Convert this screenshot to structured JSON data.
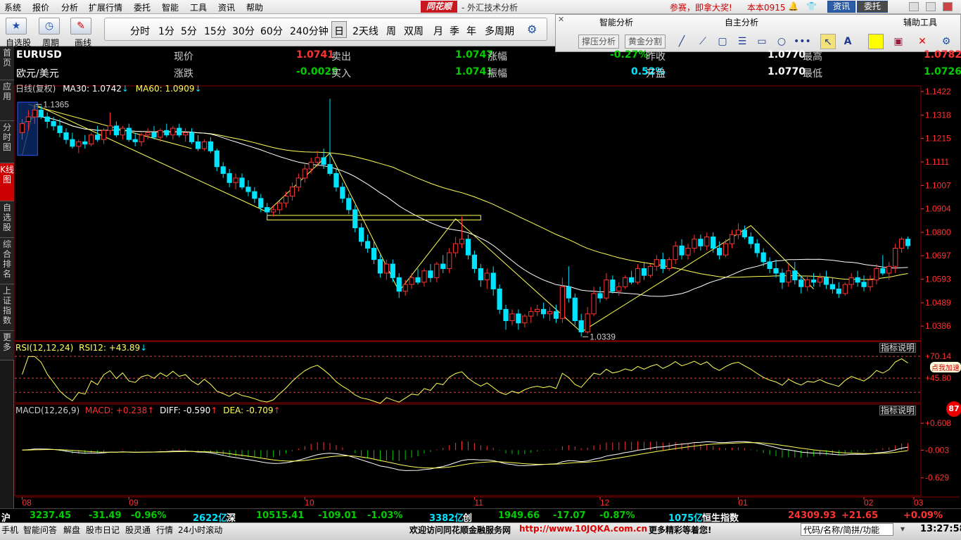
{
  "menu": [
    "系统",
    "报价",
    "分析",
    "扩展行情",
    "委托",
    "智能",
    "工具",
    "资讯",
    "帮助"
  ],
  "logo": "同花顺",
  "window_title": "- 外汇技术分析",
  "promo": "参赛，即拿大奖!",
  "version": "本本0915",
  "btn_zixun": "资讯",
  "btn_weituo": "委托",
  "toolbar": {
    "labels": [
      "自选股",
      "周期",
      "画线"
    ]
  },
  "periods": [
    "分时",
    "1分",
    "5分",
    "15分",
    "30分",
    "60分",
    "240分钟",
    "日",
    "2天线",
    "周",
    "双周",
    "月",
    "季",
    "年",
    "多周期"
  ],
  "analysis": {
    "smart": "智能分析",
    "self": "自主分析",
    "aux": "辅助工具",
    "btn1": "撑压分析",
    "btn2": "黄金分割"
  },
  "leftnav": [
    "首页",
    "应用",
    "分时图",
    "K线图",
    "自选股",
    "综合排名",
    "上证指数",
    "更多"
  ],
  "quote": {
    "symbol": "EURUSD",
    "name": "欧元/美元",
    "row1": [
      {
        "label": "现价",
        "value": "1.0741"
      },
      {
        "label": "卖出",
        "value": "1.0747"
      },
      {
        "label": "涨幅",
        "value": "-0.27%"
      },
      {
        "label": "昨收",
        "value": "1.0770"
      },
      {
        "label": "最高",
        "value": "1.0782"
      }
    ],
    "row2": [
      {
        "label": "涨跌",
        "value": "-0.0029"
      },
      {
        "label": "买入",
        "value": "1.0741"
      },
      {
        "label": "振幅",
        "value": "0.52%"
      },
      {
        "label": "开盘",
        "value": "1.0770"
      },
      {
        "label": "最低",
        "value": "1.0726"
      }
    ]
  },
  "indicator_line": {
    "mode": "日线(复权)",
    "ma30_label": "MA30: 1.0742",
    "ma60_label": "MA60: 1.0909",
    "arrow": "↓"
  },
  "rsi_header": {
    "name": "RSI(12,12,24)",
    "rsi12": "RSI12: +43.89",
    "arrow": "↓"
  },
  "macd_header": {
    "name": "MACD(12,26,9)",
    "macd": "MACD: +0.238",
    "diff": "DIFF: -0.590",
    "dea": "DEA: -0.709",
    "arrow": "↑"
  },
  "zhibiao": "指标说明",
  "dianwo": "点我加速",
  "badge_num": "87",
  "status": {
    "hu": "沪",
    "hu_val": "3237.45",
    "hu_chg": "-31.49",
    "hu_pct": "-0.96%",
    "hu_vol": "2622亿",
    "shen": "深",
    "shen_val": "10515.41",
    "shen_chg": "-109.01",
    "shen_pct": "-1.03%",
    "shen_vol": "3382亿",
    "chuang": "创",
    "chuang_val": "1949.66",
    "chuang_chg": "-17.07",
    "chuang_pct": "-0.87%",
    "chuang_vol": "1075亿",
    "hsi": "恒生指数",
    "hsi_val": "24309.93",
    "hsi_chg": "+21.65",
    "hsi_pct": "+0.09%"
  },
  "bottom": {
    "items": [
      "手机",
      "智能问答",
      "解盘",
      "股市日记",
      "股灵通",
      "行情",
      "24小时滚动"
    ],
    "welcome": "欢迎访问同花顺金融服务网",
    "url": "http://www.10JQKA.com.cn",
    "more": "更多精彩等着您!",
    "search_placeholder": "代码/名称/简拼/功能",
    "clock": "13:27:58"
  },
  "colors": {
    "up": "#ff3232",
    "down": "#00e4ff",
    "ma30": "#ffffff",
    "ma60": "#ffff55",
    "grid": "#8b0000",
    "axis": "#ff3333",
    "green": "#00cc00"
  },
  "chart_data": [
    {
      "type": "candlestick",
      "title": "EURUSD 日线",
      "y_ticks": [
        1.1422,
        1.1318,
        1.1215,
        1.1111,
        1.1007,
        1.0904,
        1.08,
        1.0697,
        1.0593,
        1.0489,
        1.0386
      ],
      "x_labels": [
        "08",
        "09",
        "10",
        "11",
        "12",
        "01",
        "02",
        "03"
      ],
      "ylim": [
        1.034,
        1.1422
      ],
      "annotations": [
        {
          "text": "1.1365",
          "value": 1.1365
        },
        {
          "text": "1.0339",
          "value": 1.0339
        }
      ],
      "ma30_last": 1.0742,
      "ma60_last": 1.0909,
      "candles": [
        {
          "o": 1.124,
          "h": 1.13,
          "l": 1.121,
          "c": 1.128
        },
        {
          "o": 1.129,
          "h": 1.134,
          "l": 1.125,
          "c": 1.131
        },
        {
          "o": 1.131,
          "h": 1.1365,
          "l": 1.128,
          "c": 1.134
        },
        {
          "o": 1.134,
          "h": 1.136,
          "l": 1.13,
          "c": 1.131
        },
        {
          "o": 1.131,
          "h": 1.133,
          "l": 1.126,
          "c": 1.129
        },
        {
          "o": 1.129,
          "h": 1.131,
          "l": 1.125,
          "c": 1.127
        },
        {
          "o": 1.127,
          "h": 1.13,
          "l": 1.122,
          "c": 1.124
        },
        {
          "o": 1.124,
          "h": 1.126,
          "l": 1.119,
          "c": 1.121
        },
        {
          "o": 1.121,
          "h": 1.124,
          "l": 1.117,
          "c": 1.118
        },
        {
          "o": 1.118,
          "h": 1.121,
          "l": 1.115,
          "c": 1.12
        },
        {
          "o": 1.12,
          "h": 1.123,
          "l": 1.117,
          "c": 1.119
        },
        {
          "o": 1.119,
          "h": 1.124,
          "l": 1.118,
          "c": 1.123
        },
        {
          "o": 1.123,
          "h": 1.127,
          "l": 1.12,
          "c": 1.121
        },
        {
          "o": 1.121,
          "h": 1.126,
          "l": 1.119,
          "c": 1.125
        },
        {
          "o": 1.125,
          "h": 1.133,
          "l": 1.123,
          "c": 1.127
        },
        {
          "o": 1.127,
          "h": 1.129,
          "l": 1.122,
          "c": 1.123
        },
        {
          "o": 1.123,
          "h": 1.127,
          "l": 1.121,
          "c": 1.126
        },
        {
          "o": 1.126,
          "h": 1.128,
          "l": 1.12,
          "c": 1.121
        },
        {
          "o": 1.121,
          "h": 1.124,
          "l": 1.118,
          "c": 1.12
        },
        {
          "o": 1.12,
          "h": 1.124,
          "l": 1.118,
          "c": 1.123
        },
        {
          "o": 1.123,
          "h": 1.126,
          "l": 1.121,
          "c": 1.124
        },
        {
          "o": 1.124,
          "h": 1.127,
          "l": 1.121,
          "c": 1.122
        },
        {
          "o": 1.122,
          "h": 1.126,
          "l": 1.12,
          "c": 1.125
        },
        {
          "o": 1.125,
          "h": 1.128,
          "l": 1.122,
          "c": 1.123
        },
        {
          "o": 1.123,
          "h": 1.127,
          "l": 1.121,
          "c": 1.126
        },
        {
          "o": 1.126,
          "h": 1.128,
          "l": 1.122,
          "c": 1.123
        },
        {
          "o": 1.123,
          "h": 1.126,
          "l": 1.12,
          "c": 1.124
        },
        {
          "o": 1.124,
          "h": 1.126,
          "l": 1.119,
          "c": 1.12
        },
        {
          "o": 1.12,
          "h": 1.123,
          "l": 1.116,
          "c": 1.117
        },
        {
          "o": 1.117,
          "h": 1.121,
          "l": 1.116,
          "c": 1.12
        },
        {
          "o": 1.12,
          "h": 1.122,
          "l": 1.115,
          "c": 1.116
        },
        {
          "o": 1.116,
          "h": 1.117,
          "l": 1.107,
          "c": 1.109
        },
        {
          "o": 1.109,
          "h": 1.111,
          "l": 1.104,
          "c": 1.106
        },
        {
          "o": 1.106,
          "h": 1.108,
          "l": 1.1,
          "c": 1.102
        },
        {
          "o": 1.102,
          "h": 1.106,
          "l": 1.099,
          "c": 1.104
        },
        {
          "o": 1.104,
          "h": 1.106,
          "l": 1.099,
          "c": 1.1
        },
        {
          "o": 1.1,
          "h": 1.103,
          "l": 1.096,
          "c": 1.098
        },
        {
          "o": 1.098,
          "h": 1.1,
          "l": 1.093,
          "c": 1.095
        },
        {
          "o": 1.095,
          "h": 1.097,
          "l": 1.089,
          "c": 1.091
        },
        {
          "o": 1.091,
          "h": 1.093,
          "l": 1.087,
          "c": 1.089
        },
        {
          "o": 1.089,
          "h": 1.092,
          "l": 1.087,
          "c": 1.09
        },
        {
          "o": 1.09,
          "h": 1.094,
          "l": 1.088,
          "c": 1.093
        },
        {
          "o": 1.093,
          "h": 1.098,
          "l": 1.091,
          "c": 1.096
        },
        {
          "o": 1.096,
          "h": 1.102,
          "l": 1.094,
          "c": 1.1
        },
        {
          "o": 1.1,
          "h": 1.106,
          "l": 1.098,
          "c": 1.104
        },
        {
          "o": 1.104,
          "h": 1.11,
          "l": 1.102,
          "c": 1.108
        },
        {
          "o": 1.108,
          "h": 1.113,
          "l": 1.106,
          "c": 1.111
        },
        {
          "o": 1.111,
          "h": 1.116,
          "l": 1.109,
          "c": 1.113
        },
        {
          "o": 1.113,
          "h": 1.117,
          "l": 1.108,
          "c": 1.11
        },
        {
          "o": 1.11,
          "h": 1.139,
          "l": 1.105,
          "c": 1.106
        },
        {
          "o": 1.106,
          "h": 1.108,
          "l": 1.098,
          "c": 1.1
        },
        {
          "o": 1.1,
          "h": 1.102,
          "l": 1.093,
          "c": 1.095
        },
        {
          "o": 1.095,
          "h": 1.097,
          "l": 1.088,
          "c": 1.09
        },
        {
          "o": 1.09,
          "h": 1.092,
          "l": 1.08,
          "c": 1.082
        },
        {
          "o": 1.082,
          "h": 1.084,
          "l": 1.074,
          "c": 1.076
        },
        {
          "o": 1.076,
          "h": 1.079,
          "l": 1.071,
          "c": 1.073
        },
        {
          "o": 1.073,
          "h": 1.076,
          "l": 1.066,
          "c": 1.068
        },
        {
          "o": 1.068,
          "h": 1.07,
          "l": 1.06,
          "c": 1.062
        },
        {
          "o": 1.062,
          "h": 1.068,
          "l": 1.059,
          "c": 1.066
        },
        {
          "o": 1.066,
          "h": 1.068,
          "l": 1.058,
          "c": 1.06
        },
        {
          "o": 1.06,
          "h": 1.062,
          "l": 1.051,
          "c": 1.054
        },
        {
          "o": 1.054,
          "h": 1.059,
          "l": 1.052,
          "c": 1.057
        },
        {
          "o": 1.057,
          "h": 1.062,
          "l": 1.055,
          "c": 1.06
        },
        {
          "o": 1.06,
          "h": 1.064,
          "l": 1.057,
          "c": 1.058
        },
        {
          "o": 1.058,
          "h": 1.064,
          "l": 1.056,
          "c": 1.063
        },
        {
          "o": 1.063,
          "h": 1.066,
          "l": 1.058,
          "c": 1.06
        },
        {
          "o": 1.06,
          "h": 1.067,
          "l": 1.058,
          "c": 1.066
        },
        {
          "o": 1.066,
          "h": 1.07,
          "l": 1.062,
          "c": 1.064
        },
        {
          "o": 1.064,
          "h": 1.073,
          "l": 1.062,
          "c": 1.071
        },
        {
          "o": 1.071,
          "h": 1.078,
          "l": 1.069,
          "c": 1.075
        },
        {
          "o": 1.075,
          "h": 1.087,
          "l": 1.073,
          "c": 1.077
        },
        {
          "o": 1.077,
          "h": 1.079,
          "l": 1.068,
          "c": 1.07
        },
        {
          "o": 1.07,
          "h": 1.072,
          "l": 1.062,
          "c": 1.064
        },
        {
          "o": 1.064,
          "h": 1.066,
          "l": 1.056,
          "c": 1.059
        },
        {
          "o": 1.059,
          "h": 1.064,
          "l": 1.055,
          "c": 1.062
        },
        {
          "o": 1.062,
          "h": 1.065,
          "l": 1.052,
          "c": 1.055
        },
        {
          "o": 1.055,
          "h": 1.057,
          "l": 1.044,
          "c": 1.046
        },
        {
          "o": 1.046,
          "h": 1.048,
          "l": 1.037,
          "c": 1.041
        },
        {
          "o": 1.041,
          "h": 1.046,
          "l": 1.039,
          "c": 1.044
        },
        {
          "o": 1.044,
          "h": 1.046,
          "l": 1.037,
          "c": 1.04
        },
        {
          "o": 1.04,
          "h": 1.044,
          "l": 1.038,
          "c": 1.043
        },
        {
          "o": 1.043,
          "h": 1.047,
          "l": 1.04,
          "c": 1.045
        },
        {
          "o": 1.045,
          "h": 1.048,
          "l": 1.043,
          "c": 1.046
        },
        {
          "o": 1.046,
          "h": 1.049,
          "l": 1.042,
          "c": 1.044
        },
        {
          "o": 1.044,
          "h": 1.047,
          "l": 1.041,
          "c": 1.045
        },
        {
          "o": 1.045,
          "h": 1.048,
          "l": 1.04,
          "c": 1.042
        },
        {
          "o": 1.042,
          "h": 1.06,
          "l": 1.04,
          "c": 1.056
        },
        {
          "o": 1.056,
          "h": 1.065,
          "l": 1.049,
          "c": 1.051
        },
        {
          "o": 1.051,
          "h": 1.053,
          "l": 1.039,
          "c": 1.041
        },
        {
          "o": 1.041,
          "h": 1.044,
          "l": 1.034,
          "c": 1.036
        },
        {
          "o": 1.036,
          "h": 1.047,
          "l": 1.035,
          "c": 1.044
        },
        {
          "o": 1.044,
          "h": 1.056,
          "l": 1.043,
          "c": 1.053
        },
        {
          "o": 1.053,
          "h": 1.056,
          "l": 1.049,
          "c": 1.051
        },
        {
          "o": 1.051,
          "h": 1.062,
          "l": 1.05,
          "c": 1.059
        },
        {
          "o": 1.059,
          "h": 1.061,
          "l": 1.053,
          "c": 1.054
        },
        {
          "o": 1.054,
          "h": 1.058,
          "l": 1.052,
          "c": 1.056
        },
        {
          "o": 1.056,
          "h": 1.061,
          "l": 1.055,
          "c": 1.06
        },
        {
          "o": 1.06,
          "h": 1.063,
          "l": 1.057,
          "c": 1.058
        },
        {
          "o": 1.058,
          "h": 1.066,
          "l": 1.057,
          "c": 1.064
        },
        {
          "o": 1.064,
          "h": 1.067,
          "l": 1.059,
          "c": 1.061
        },
        {
          "o": 1.061,
          "h": 1.066,
          "l": 1.06,
          "c": 1.065
        },
        {
          "o": 1.065,
          "h": 1.07,
          "l": 1.063,
          "c": 1.068
        },
        {
          "o": 1.068,
          "h": 1.071,
          "l": 1.062,
          "c": 1.064
        },
        {
          "o": 1.064,
          "h": 1.069,
          "l": 1.063,
          "c": 1.068
        },
        {
          "o": 1.068,
          "h": 1.076,
          "l": 1.066,
          "c": 1.074
        },
        {
          "o": 1.074,
          "h": 1.077,
          "l": 1.068,
          "c": 1.07
        },
        {
          "o": 1.07,
          "h": 1.075,
          "l": 1.068,
          "c": 1.073
        },
        {
          "o": 1.073,
          "h": 1.079,
          "l": 1.071,
          "c": 1.077
        },
        {
          "o": 1.077,
          "h": 1.079,
          "l": 1.072,
          "c": 1.074
        },
        {
          "o": 1.074,
          "h": 1.08,
          "l": 1.072,
          "c": 1.078
        },
        {
          "o": 1.078,
          "h": 1.08,
          "l": 1.071,
          "c": 1.073
        },
        {
          "o": 1.073,
          "h": 1.076,
          "l": 1.068,
          "c": 1.07
        },
        {
          "o": 1.07,
          "h": 1.077,
          "l": 1.069,
          "c": 1.075
        },
        {
          "o": 1.075,
          "h": 1.081,
          "l": 1.073,
          "c": 1.079
        },
        {
          "o": 1.079,
          "h": 1.084,
          "l": 1.077,
          "c": 1.081
        },
        {
          "o": 1.081,
          "h": 1.083,
          "l": 1.077,
          "c": 1.078
        },
        {
          "o": 1.078,
          "h": 1.08,
          "l": 1.073,
          "c": 1.075
        },
        {
          "o": 1.075,
          "h": 1.077,
          "l": 1.069,
          "c": 1.071
        },
        {
          "o": 1.071,
          "h": 1.073,
          "l": 1.065,
          "c": 1.067
        },
        {
          "o": 1.067,
          "h": 1.069,
          "l": 1.062,
          "c": 1.064
        },
        {
          "o": 1.064,
          "h": 1.068,
          "l": 1.06,
          "c": 1.062
        },
        {
          "o": 1.062,
          "h": 1.064,
          "l": 1.055,
          "c": 1.058
        },
        {
          "o": 1.058,
          "h": 1.066,
          "l": 1.056,
          "c": 1.063
        },
        {
          "o": 1.063,
          "h": 1.067,
          "l": 1.057,
          "c": 1.059
        },
        {
          "o": 1.059,
          "h": 1.061,
          "l": 1.053,
          "c": 1.056
        },
        {
          "o": 1.056,
          "h": 1.061,
          "l": 1.054,
          "c": 1.059
        },
        {
          "o": 1.059,
          "h": 1.062,
          "l": 1.056,
          "c": 1.058
        },
        {
          "o": 1.058,
          "h": 1.062,
          "l": 1.056,
          "c": 1.06
        },
        {
          "o": 1.06,
          "h": 1.063,
          "l": 1.055,
          "c": 1.057
        },
        {
          "o": 1.057,
          "h": 1.06,
          "l": 1.053,
          "c": 1.055
        },
        {
          "o": 1.055,
          "h": 1.058,
          "l": 1.051,
          "c": 1.053
        },
        {
          "o": 1.053,
          "h": 1.058,
          "l": 1.052,
          "c": 1.057
        },
        {
          "o": 1.057,
          "h": 1.062,
          "l": 1.055,
          "c": 1.06
        },
        {
          "o": 1.06,
          "h": 1.063,
          "l": 1.056,
          "c": 1.058
        },
        {
          "o": 1.058,
          "h": 1.061,
          "l": 1.054,
          "c": 1.056
        },
        {
          "o": 1.056,
          "h": 1.061,
          "l": 1.054,
          "c": 1.059
        },
        {
          "o": 1.059,
          "h": 1.066,
          "l": 1.057,
          "c": 1.064
        },
        {
          "o": 1.064,
          "h": 1.07,
          "l": 1.061,
          "c": 1.062
        },
        {
          "o": 1.062,
          "h": 1.067,
          "l": 1.059,
          "c": 1.065
        },
        {
          "o": 1.065,
          "h": 1.075,
          "l": 1.062,
          "c": 1.073
        },
        {
          "o": 1.073,
          "h": 1.078,
          "l": 1.071,
          "c": 1.077
        },
        {
          "o": 1.077,
          "h": 1.0782,
          "l": 1.0726,
          "c": 1.0741
        }
      ],
      "rsi": {
        "series": [
          {
            "name": "RSI12",
            "last": 43.89
          }
        ],
        "levels": [
          70.14,
          45.8
        ],
        "ylim": [
          20,
          75
        ]
      },
      "macd": {
        "series": [
          {
            "name": "DIFF",
            "last": -0.59
          },
          {
            "name": "DEA",
            "last": -0.709
          }
        ],
        "histogram_last": 0.238,
        "ticks": [
          0.608,
          -0.003,
          -0.629
        ],
        "ylim": [
          -1.0,
          0.85
        ]
      }
    }
  ]
}
